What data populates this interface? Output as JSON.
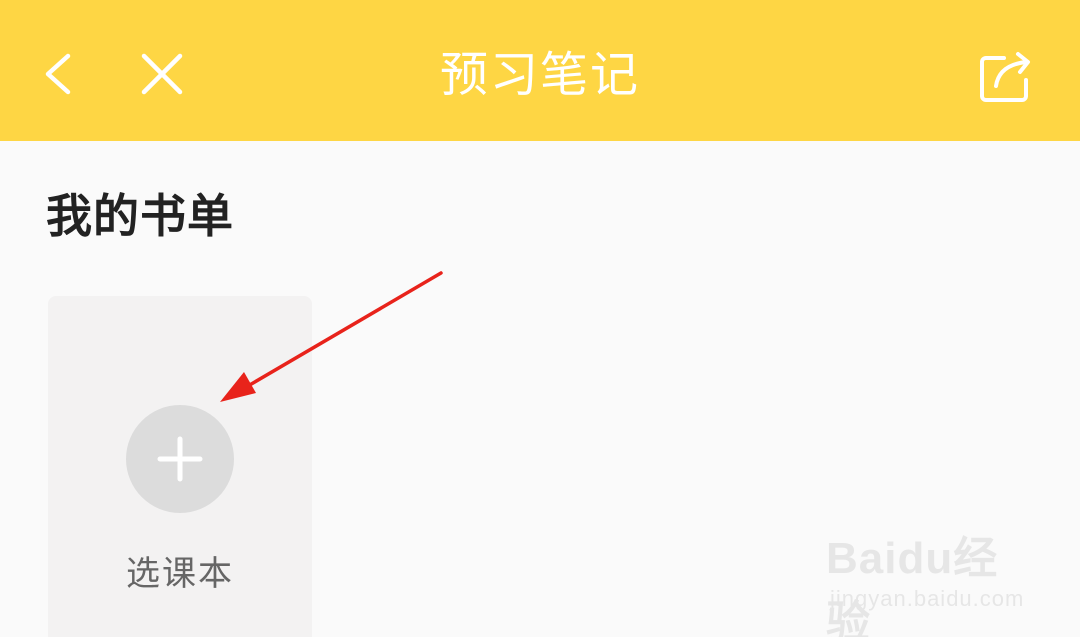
{
  "header": {
    "title": "预习笔记",
    "back_icon": "back-chevron-icon",
    "close_icon": "close-icon",
    "share_icon": "share-icon",
    "bg_color": "#fed644"
  },
  "section": {
    "title": "我的书单"
  },
  "book_list": {
    "add_label": "选课本",
    "add_icon": "plus-icon"
  },
  "watermark": {
    "logo_text": "Baidu经验",
    "url": "jingyan.baidu.com"
  },
  "annotation": {
    "arrow_color": "#e8231b"
  }
}
